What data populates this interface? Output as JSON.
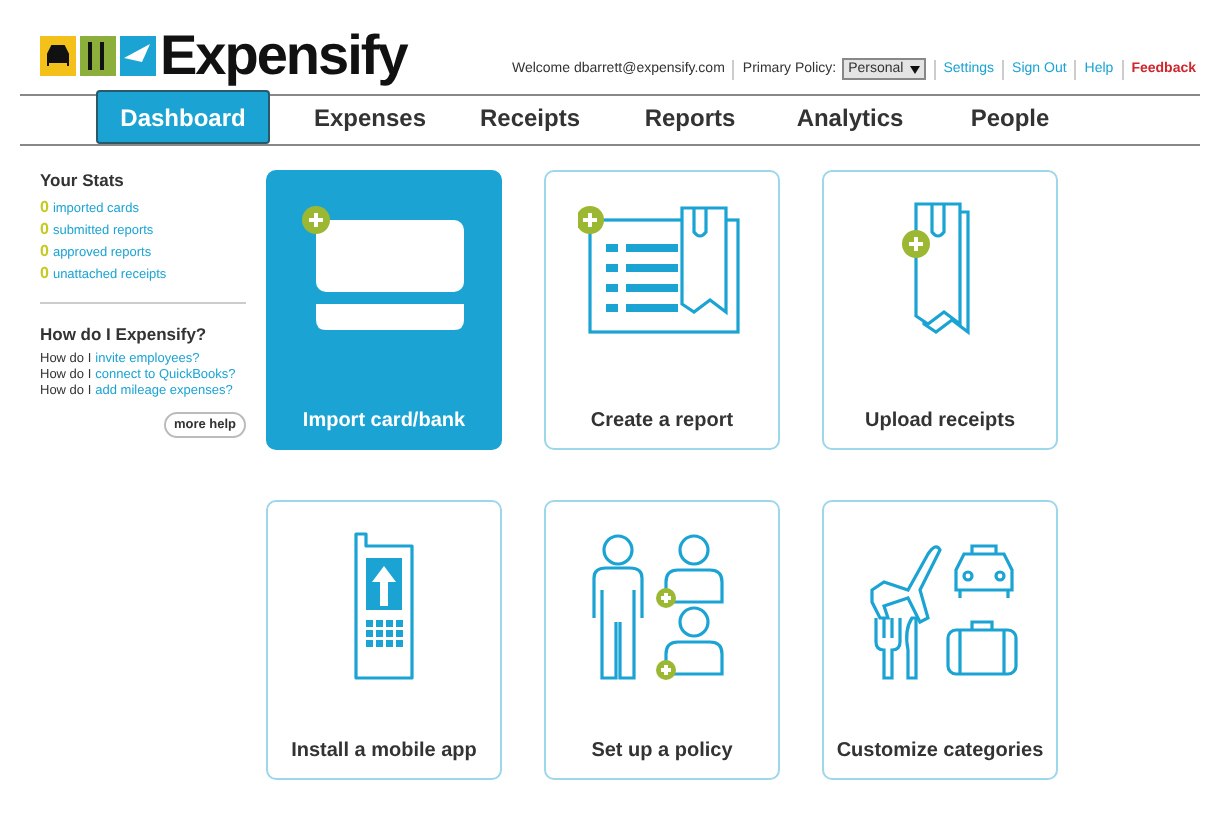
{
  "logo": {
    "text": "Expensify"
  },
  "header": {
    "welcome": "Welcome dbarrett@expensify.com",
    "policy_label": "Primary Policy:",
    "policy_value": "Personal",
    "links": [
      {
        "label": "Settings",
        "kind": "link"
      },
      {
        "label": "Sign Out",
        "kind": "link"
      },
      {
        "label": "Help",
        "kind": "link"
      },
      {
        "label": "Feedback",
        "kind": "alert"
      }
    ]
  },
  "tabs": [
    {
      "label": "Dashboard",
      "selected": true
    },
    {
      "label": "Expenses",
      "selected": false
    },
    {
      "label": "Receipts",
      "selected": false
    },
    {
      "label": "Reports",
      "selected": false
    },
    {
      "label": "Analytics",
      "selected": false
    },
    {
      "label": "People",
      "selected": false
    }
  ],
  "sidebar": {
    "stats_title": "Your Stats",
    "stats": [
      {
        "count": "0",
        "label": "imported cards"
      },
      {
        "count": "0",
        "label": "submitted reports"
      },
      {
        "count": "0",
        "label": "approved reports"
      },
      {
        "count": "0",
        "label": "unattached receipts"
      }
    ],
    "help_title": "How do I Expensify?",
    "help": [
      {
        "prefix": "How do I",
        "link": "invite employees?"
      },
      {
        "prefix": "How do I",
        "link": "connect to QuickBooks?"
      },
      {
        "prefix": "How do I",
        "link": "add mileage expenses?"
      }
    ],
    "more_help": "more help"
  },
  "tiles": [
    {
      "label": "Import card/bank",
      "kind": "card",
      "selected": true
    },
    {
      "label": "Create a report",
      "kind": "report",
      "selected": false
    },
    {
      "label": "Upload receipts",
      "kind": "receipts",
      "selected": false
    },
    {
      "label": "Install a mobile app",
      "kind": "mobile",
      "selected": false
    },
    {
      "label": "Set up a policy",
      "kind": "policy",
      "selected": false
    },
    {
      "label": "Customize categories",
      "kind": "categories",
      "selected": false
    }
  ]
}
